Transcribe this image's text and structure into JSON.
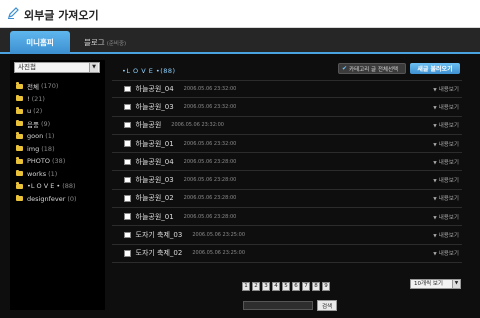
{
  "header": {
    "title": "외부글 가져오기",
    "icon": "pencil-icon"
  },
  "tabs": [
    {
      "label": "미니홈피",
      "active": true
    },
    {
      "label": "블로그",
      "sub": "(준비중)",
      "active": false
    }
  ],
  "sidebar": {
    "select_value": "사진첩",
    "categories": [
      {
        "name": "전체",
        "count": "(170)"
      },
      {
        "name": "!",
        "count": "(21)"
      },
      {
        "name": "u",
        "count": "(2)"
      },
      {
        "name": "음풍",
        "count": "(9)"
      },
      {
        "name": "goon",
        "count": "(1)"
      },
      {
        "name": "img",
        "count": "(18)"
      },
      {
        "name": "PHOTO",
        "count": "(38)"
      },
      {
        "name": "works",
        "count": "(1)"
      },
      {
        "name": "•L O V E •",
        "count": "(88)"
      },
      {
        "name": "designfever",
        "count": "(0)"
      }
    ]
  },
  "main": {
    "title": "•L O V E •(88)",
    "check_all_label": "카테고리 글 전체선택",
    "import_button_label": "새글 불러오기",
    "view_label": "내용보기",
    "rows": [
      {
        "title": "하늘공원_04",
        "date": "2006.05.06 23:32:00"
      },
      {
        "title": "하늘공원_03",
        "date": "2006.05.06 23:32:00"
      },
      {
        "title": "하늘공원",
        "date": "2006.05.06 23:32:00"
      },
      {
        "title": "하늘공원_01",
        "date": "2006.05.06 23:32:00"
      },
      {
        "title": "하늘공원_04",
        "date": "2006.05.06 23:28:00"
      },
      {
        "title": "하늘공원_03",
        "date": "2006.05.06 23:28:00"
      },
      {
        "title": "하늘공원_02",
        "date": "2006.05.06 23:28:00"
      },
      {
        "title": "하늘공원_01",
        "date": "2006.05.06 23:28:00"
      },
      {
        "title": "도자기 축제_03",
        "date": "2006.05.06 23:25:00"
      },
      {
        "title": "도자기 축제_02",
        "date": "2006.05.06 23:25:00"
      }
    ],
    "pages": [
      "1",
      "2",
      "3",
      "4",
      "5",
      "6",
      "7",
      "8",
      "9"
    ],
    "page_size_value": "10개씩 보기",
    "search_button_label": "검색"
  }
}
